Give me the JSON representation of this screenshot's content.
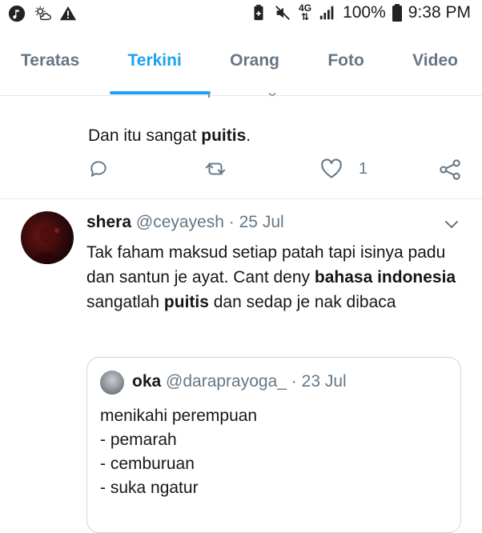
{
  "status_bar": {
    "battery": "100%",
    "time": "9:38 PM",
    "network": "4G",
    "left_icons": [
      "music-note-icon",
      "weather-icon",
      "warning-icon"
    ],
    "right_icons": [
      "battery-saver-icon",
      "mute-icon",
      "network-4g-icon",
      "signal-icon",
      "battery-icon"
    ]
  },
  "tabs": [
    {
      "label": "Teratas"
    },
    {
      "label": "Terkini",
      "active": true
    },
    {
      "label": "Orang"
    },
    {
      "label": "Foto"
    },
    {
      "label": "Video"
    }
  ],
  "tweet1": {
    "text_prefix": "Dan itu sangat ",
    "text_bold": "puitis",
    "text_suffix": ".",
    "like_count": "1"
  },
  "tweet2": {
    "name": "shera",
    "handle": "@ceyayesh",
    "sep": "·",
    "date": "25 Jul",
    "body_1": "Tak faham maksud setiap patah tapi isinya padu dan santun je ayat. Cant deny ",
    "body_bold_1": "bahasa indonesia",
    "body_2": " sangatlah ",
    "body_bold_2": "puitis",
    "body_3": " dan sedap je nak dibaca"
  },
  "quote": {
    "name": "oka",
    "handle": "@daraprayoga_",
    "sep": "·",
    "date": "23 Jul",
    "lines": [
      "menikahi perempuan",
      "- pemarah",
      "- cemburuan",
      "- suka ngatur"
    ]
  },
  "colors": {
    "accent": "#1da1f2",
    "muted": "#657786",
    "text": "#14171a",
    "divider": "#e1e8ed"
  }
}
